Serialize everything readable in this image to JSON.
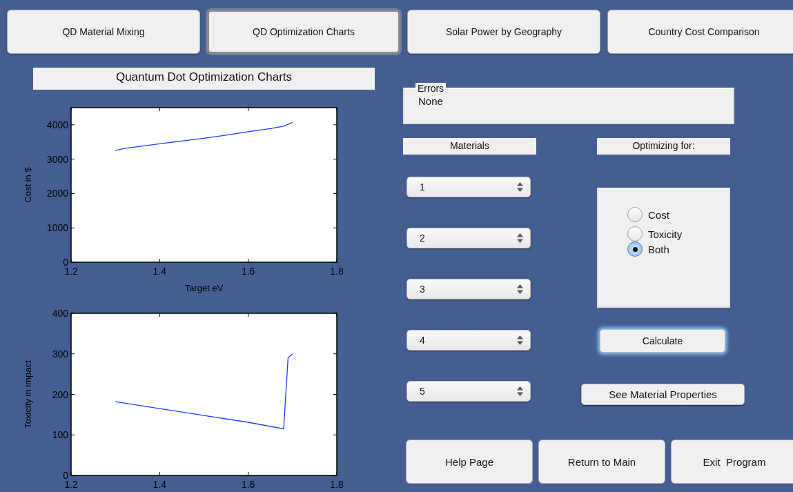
{
  "tabs": [
    {
      "label": "QD Material Mixing",
      "selected": false
    },
    {
      "label": "QD Optimization Charts",
      "selected": true
    },
    {
      "label": "Solar Power by Geography",
      "selected": false
    },
    {
      "label": "Country Cost Comparison",
      "selected": false
    }
  ],
  "charts_title": "Quantum Dot Optimization Charts",
  "charts": [
    {
      "chart_data": {
        "type": "line",
        "xlabel": "Target eV",
        "ylabel": "Cost in $",
        "x": [
          1.3,
          1.32,
          1.35,
          1.4,
          1.45,
          1.5,
          1.55,
          1.6,
          1.65,
          1.68,
          1.7
        ],
        "series": [
          {
            "color": "#1f3cff",
            "values": [
              3250,
              3310,
              3360,
              3450,
              3530,
              3610,
              3700,
              3800,
              3890,
              3960,
              4070
            ]
          }
        ],
        "xlim": [
          1.2,
          1.8
        ],
        "ylim": [
          0,
          4500
        ],
        "xticks": [
          1.2,
          1.4,
          1.6,
          1.8
        ],
        "yticks": [
          0,
          1000,
          2000,
          3000,
          4000
        ]
      }
    },
    {
      "chart_data": {
        "type": "line",
        "ylabel": "Toxicity in impact",
        "x": [
          1.3,
          1.4,
          1.5,
          1.6,
          1.68,
          1.69,
          1.7
        ],
        "series": [
          {
            "color": "#1f3cff",
            "values": [
              182,
              165,
              148,
              131,
              115,
              290,
              300
            ]
          }
        ],
        "xlim": [
          1.2,
          1.8
        ],
        "ylim": [
          0,
          400
        ],
        "xticks": [
          1.2,
          1.4,
          1.6,
          1.8
        ],
        "yticks": [
          0,
          100,
          200,
          300,
          400
        ]
      }
    }
  ],
  "errors": {
    "legend": "Errors",
    "text": "None"
  },
  "materials": {
    "label": "Materials",
    "dropdowns": [
      "1",
      "2",
      "3",
      "4",
      "5"
    ]
  },
  "optimizing": {
    "label": "Optimizing for:",
    "options": [
      {
        "label": "Cost",
        "selected": false
      },
      {
        "label": "Toxicity",
        "selected": false
      },
      {
        "label": "Both",
        "selected": true
      }
    ]
  },
  "calculate_button": {
    "label": "Calculate",
    "focused": true
  },
  "properties_button": "See Material Properties",
  "bottom_buttons": [
    "Help Page",
    "Return to Main",
    "Exit  Program"
  ]
}
